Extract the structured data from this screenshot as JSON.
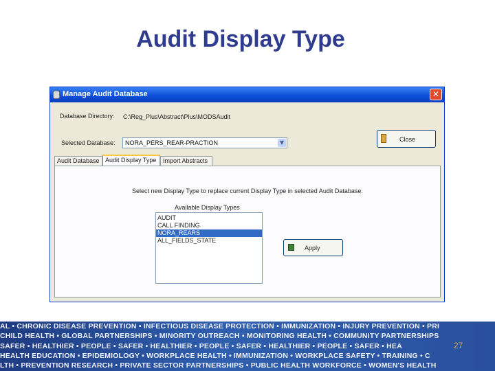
{
  "slide": {
    "title": "Audit Display Type",
    "page_number": "27"
  },
  "window": {
    "title": "Manage Audit Database",
    "close_glyph": "✕"
  },
  "form": {
    "db_dir_label": "Database Directory:",
    "db_dir_value": "C:\\Reg_Plus\\Abstract\\Plus\\MODSAudit",
    "selected_db_label": "Selected Database:",
    "selected_db_value": "NORA_PERS_REAR-PRACTION",
    "close_button": "Close"
  },
  "tabs": [
    {
      "label": "Audit Database",
      "active": false
    },
    {
      "label": "Audit Display Type",
      "active": true
    },
    {
      "label": "Import Abstracts",
      "active": false
    }
  ],
  "panel": {
    "instruction": "Select new Display Type to replace current Display Type in selected Audit Database.",
    "list_caption": "Available Display Types",
    "items": [
      {
        "label": "AUDIT",
        "selected": false
      },
      {
        "label": "CALL FINDING",
        "selected": false
      },
      {
        "label": "NORA_REARS",
        "selected": true
      },
      {
        "label": "ALL_FIELDS_STATE",
        "selected": false
      }
    ],
    "apply_button": "Apply"
  },
  "icons": {
    "window": "database-icon",
    "close_button": "door-icon",
    "apply_button": "apply-icon",
    "combo_arrow": "chevron-down-icon"
  },
  "banner_lines": [
    "AL • CHRONIC DISEASE PREVENTION • INFECTIOUS DISEASE PROTECTION • IMMUNIZATION • INJURY PREVENTION • PRI",
    "CHILD HEALTH • GLOBAL PARTNERSHIPS • MINORITY OUTREACH • MONITORING HEALTH • COMMUNITY PARTNERSHIPS",
    "SAFER • HEALTHIER • PEOPLE • SAFER • HEALTHIER • PEOPLE • SAFER • HEALTHIER • PEOPLE • SAFER • HEA",
    "HEALTH EDUCATION • EPIDEMIOLOGY • WORKPLACE HEALTH • IMMUNIZATION • WORKPLACE SAFETY • TRAINING • C",
    "LTH • PREVENTION RESEARCH • PRIVATE SECTOR PARTNERSHIPS • PUBLIC HEALTH WORKFORCE • WOMEN'S HEALTH"
  ],
  "colors": {
    "title": "#2f3b8f",
    "titlebar": "#0b4fd8",
    "selection": "#316ac5",
    "banner": "#2f5fae",
    "page_number": "#d6a64a"
  }
}
